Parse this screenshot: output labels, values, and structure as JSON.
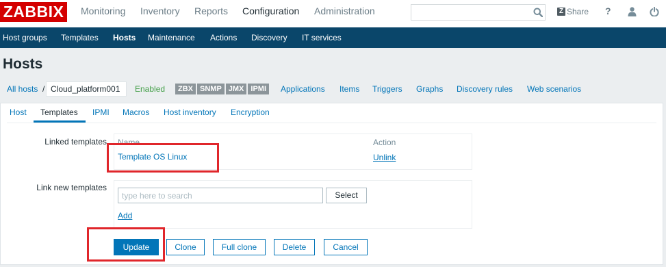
{
  "colors": {
    "brand_red": "#d40000",
    "nav_blue": "#0a466a",
    "link_blue": "#0275b8",
    "status_green": "#429e47",
    "badge_grey": "#8c959a",
    "highlight_red": "#e0262b"
  },
  "header": {
    "logo": "ZABBIX",
    "menu": [
      {
        "label": "Monitoring",
        "active": false
      },
      {
        "label": "Inventory",
        "active": false
      },
      {
        "label": "Reports",
        "active": false
      },
      {
        "label": "Configuration",
        "active": true
      },
      {
        "label": "Administration",
        "active": false
      }
    ],
    "search": {
      "value": "",
      "icon": "search-icon"
    },
    "share": {
      "icon": "zabbix-share-icon",
      "icon_glyph": "Z",
      "label": "Share"
    },
    "help": {
      "icon": "help-icon",
      "label": "?"
    },
    "user": {
      "icon": "user-icon"
    },
    "sign_out": {
      "icon": "power-icon"
    }
  },
  "subnav": {
    "items": [
      {
        "label": "Host groups",
        "active": false
      },
      {
        "label": "Templates",
        "active": false
      },
      {
        "label": "Hosts",
        "active": true
      },
      {
        "label": "Maintenance",
        "active": false
      },
      {
        "label": "Actions",
        "active": false
      },
      {
        "label": "Discovery",
        "active": false
      },
      {
        "label": "IT services",
        "active": false
      }
    ]
  },
  "page_title": "Hosts",
  "host_nav": {
    "all_hosts": "All hosts",
    "separator": "/",
    "host_name": "Cloud_platform001",
    "status": "Enabled",
    "availability": [
      "ZBX",
      "SNMP",
      "JMX",
      "IPMI"
    ],
    "links": [
      "Applications",
      "Items",
      "Triggers",
      "Graphs",
      "Discovery rules",
      "Web scenarios"
    ]
  },
  "tabs": [
    {
      "label": "Host",
      "active": false
    },
    {
      "label": "Templates",
      "active": true
    },
    {
      "label": "IPMI",
      "active": false
    },
    {
      "label": "Macros",
      "active": false
    },
    {
      "label": "Host inventory",
      "active": false
    },
    {
      "label": "Encryption",
      "active": false
    }
  ],
  "linked_templates": {
    "label": "Linked templates",
    "columns": [
      "Name",
      "Action"
    ],
    "rows": [
      {
        "name": "Template OS Linux",
        "action": "Unlink"
      }
    ]
  },
  "link_new_templates": {
    "label": "Link new templates",
    "search": {
      "value": "",
      "placeholder": "type here to search"
    },
    "select_label": "Select",
    "add_label": "Add"
  },
  "form_buttons": {
    "update": "Update",
    "clone": "Clone",
    "full_clone": "Full clone",
    "delete": "Delete",
    "cancel": "Cancel"
  }
}
